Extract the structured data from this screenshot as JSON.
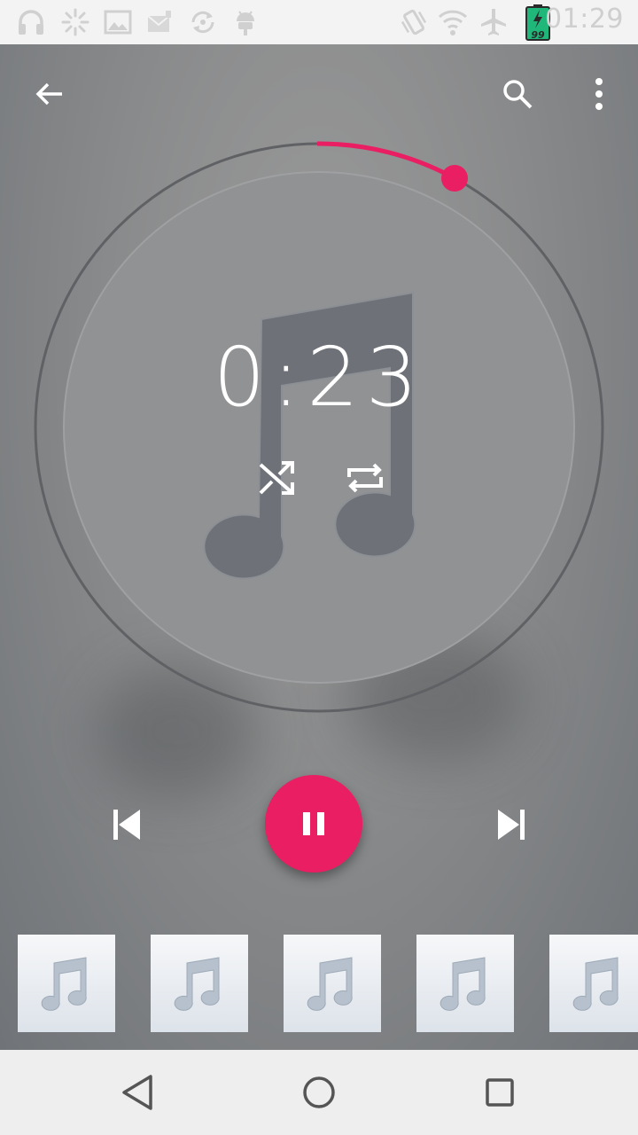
{
  "status_bar": {
    "time": "01:29",
    "battery_level": "99",
    "icons": [
      "headphones-icon",
      "loading-icon",
      "image-icon",
      "mail-icon",
      "sync-icon",
      "android-icon",
      "vibrate-icon",
      "wifi-icon",
      "airplane-icon",
      "battery-icon"
    ]
  },
  "player": {
    "elapsed": "0:23",
    "accent_color": "#e91e63",
    "state": "playing"
  },
  "queue": {
    "thumbnails": [
      "music-note-icon",
      "music-note-icon",
      "music-note-icon",
      "music-note-icon",
      "music-note-icon"
    ]
  },
  "nav": {
    "buttons": [
      "back",
      "home",
      "recents"
    ]
  }
}
